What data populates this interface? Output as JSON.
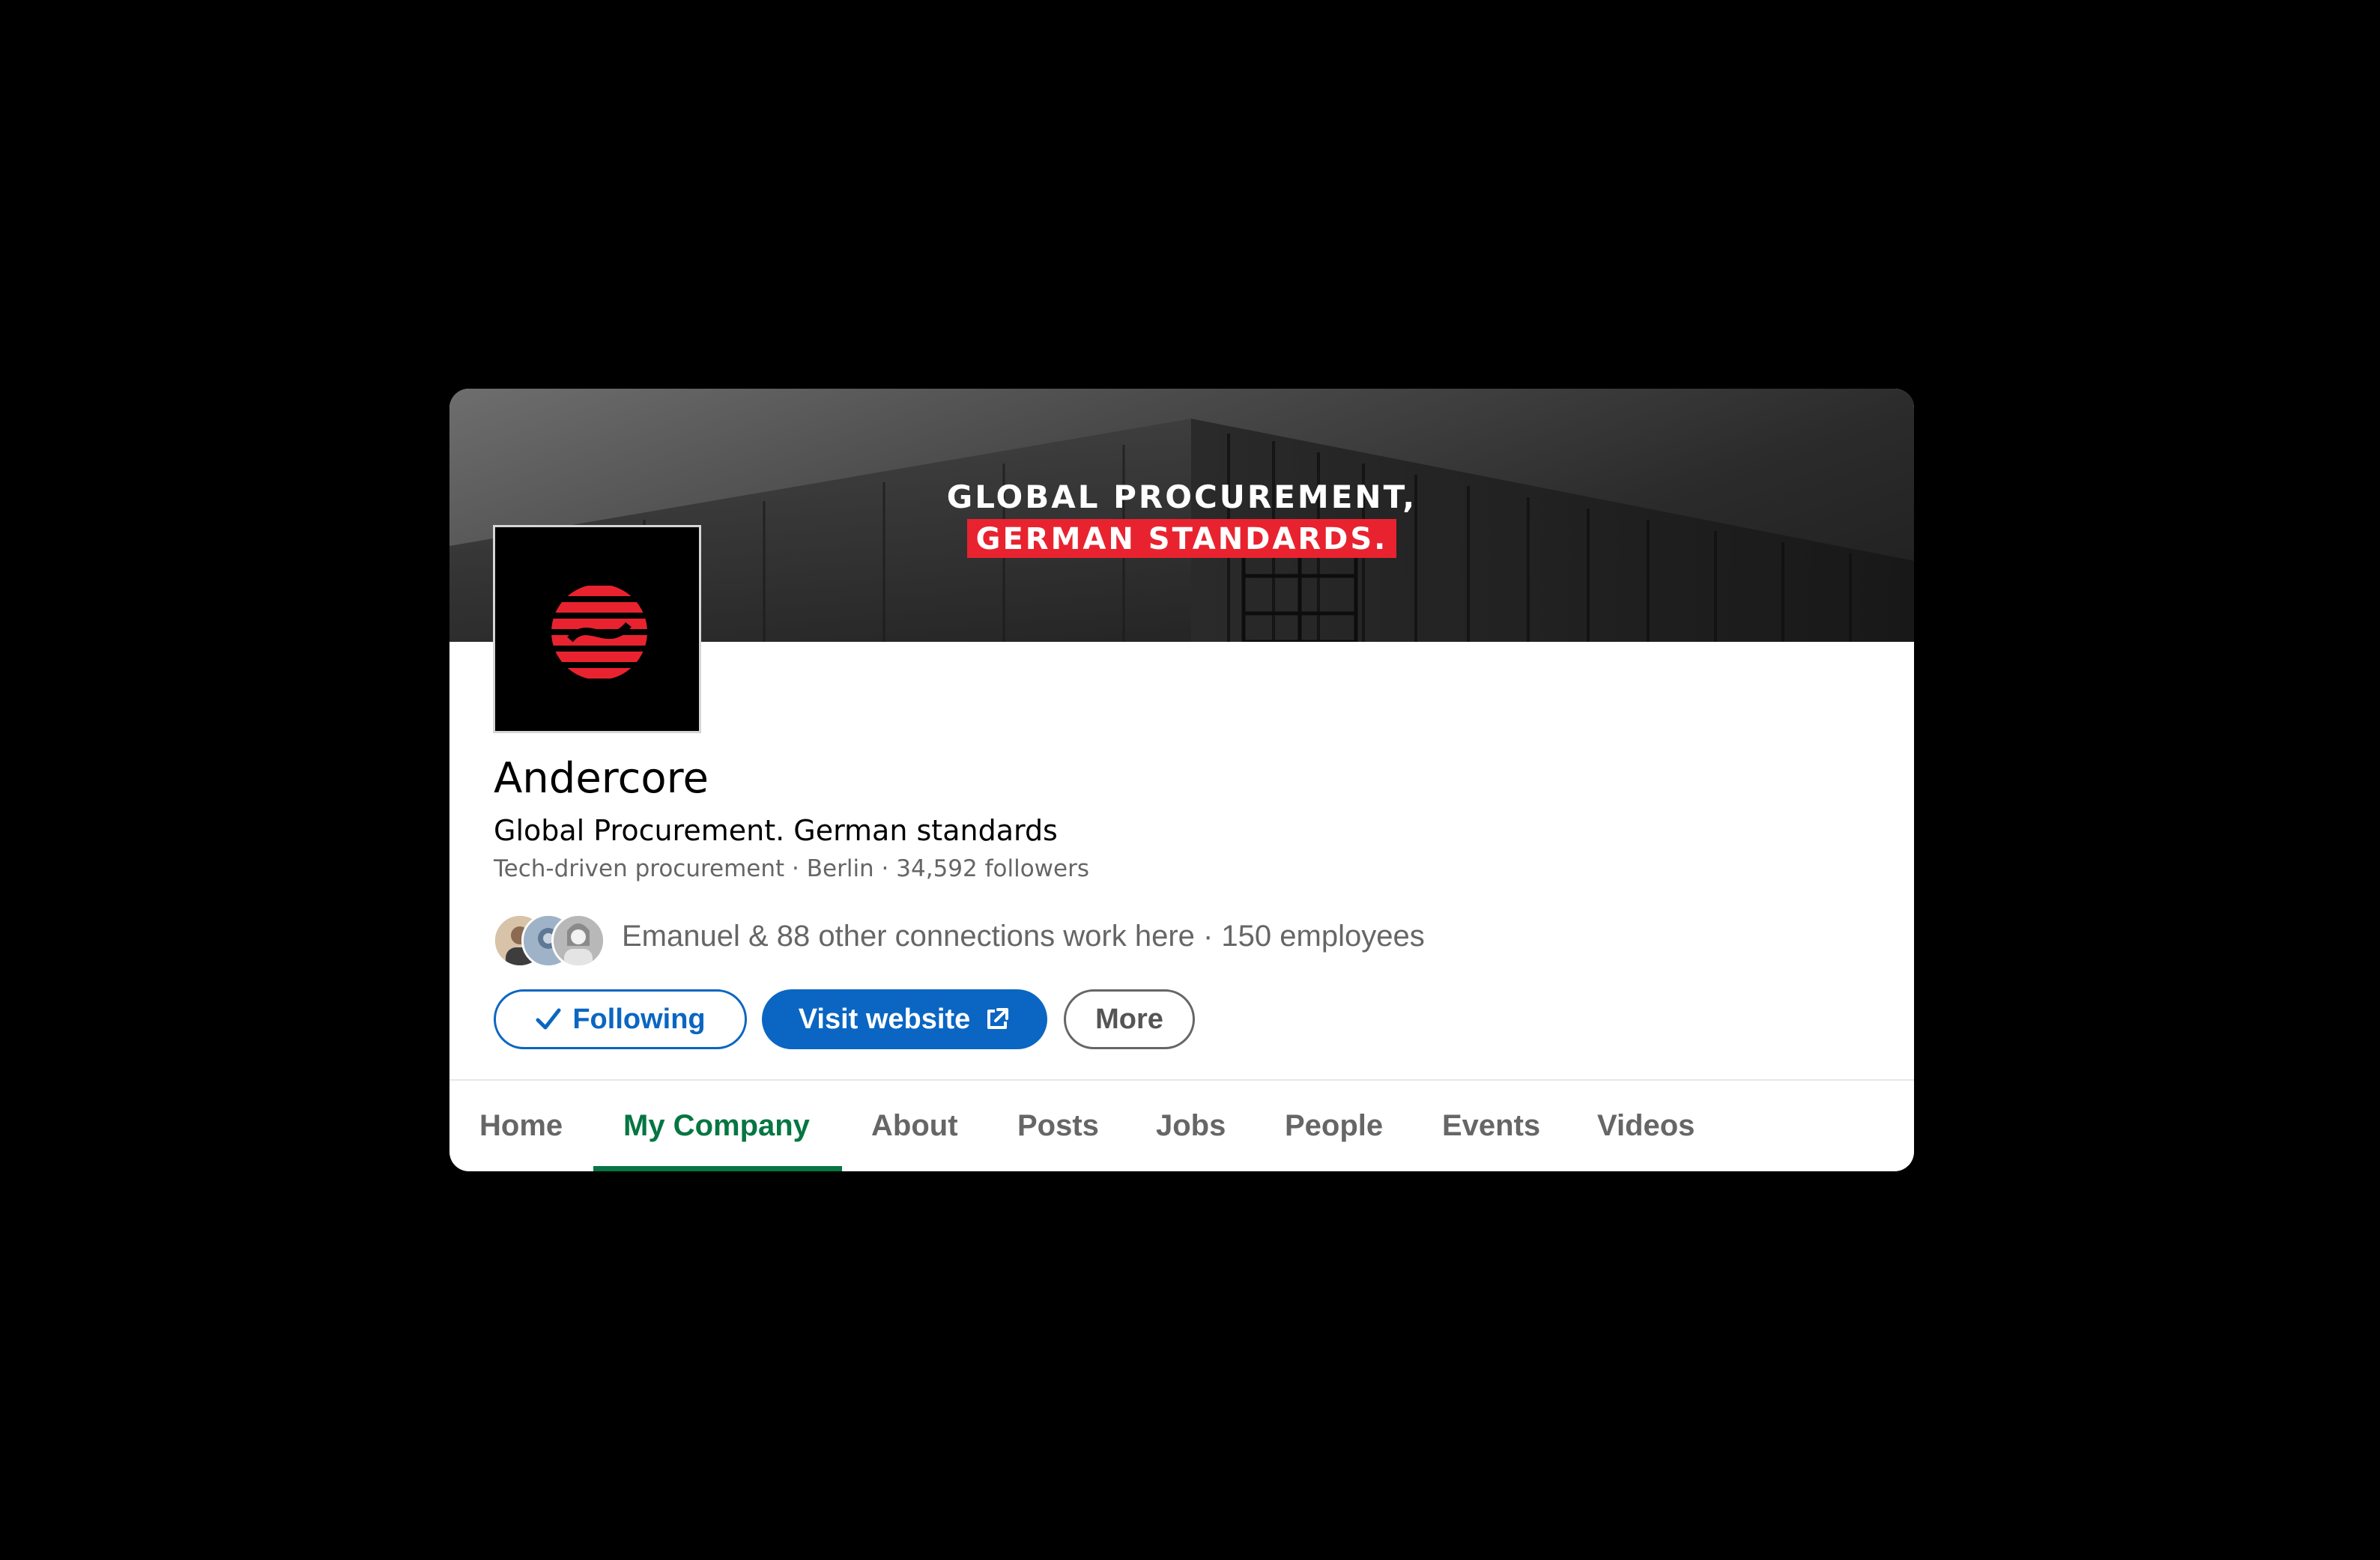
{
  "banner": {
    "line1": "GLOBAL PROCUREMENT,",
    "line2": "GERMAN STANDARDS.",
    "accent_color": "#e8232f"
  },
  "company": {
    "name": "Andercore",
    "tagline": "Global Procurement. German standards",
    "meta": "Tech-driven procurement · Berlin · 34,592 followers",
    "connections": "Emanuel & 88 other connections work here · 150 employees"
  },
  "actions": {
    "following_label": "Following",
    "following_icon": "checkmark-icon",
    "visit_label": "Visit website",
    "visit_icon": "external-link-icon",
    "more_label": "More",
    "primary_color": "#0a66c2"
  },
  "tabs": [
    {
      "label": "Home"
    },
    {
      "label": "My Company",
      "active": true
    },
    {
      "label": "About"
    },
    {
      "label": "Posts"
    },
    {
      "label": "Jobs"
    },
    {
      "label": "People"
    },
    {
      "label": "Events"
    },
    {
      "label": "Videos"
    }
  ],
  "active_tab_color": "#057642"
}
